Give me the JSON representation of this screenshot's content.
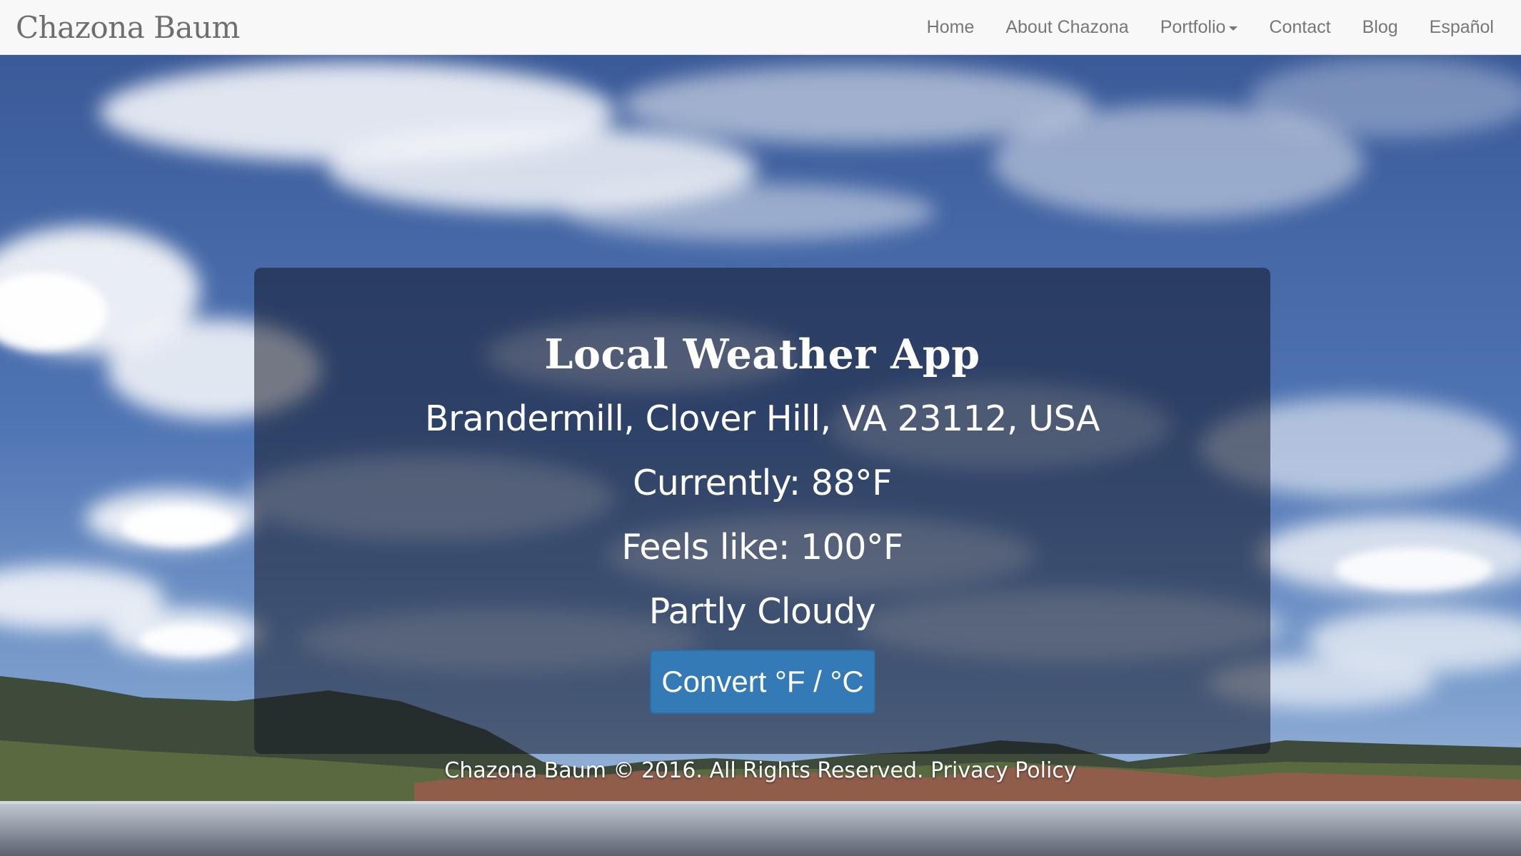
{
  "navbar": {
    "brand": "Chazona Baum",
    "items": [
      {
        "label": "Home"
      },
      {
        "label": "About Chazona"
      },
      {
        "label": "Portfolio",
        "has_dropdown": true
      },
      {
        "label": "Contact"
      },
      {
        "label": "Blog"
      },
      {
        "label": "Español"
      }
    ]
  },
  "weather": {
    "title": "Local Weather App",
    "location": "Brandermill, Clover Hill, VA 23112, USA",
    "current": "Currently: 88°F",
    "feels_like": "Feels like: 100°F",
    "condition": "Partly Cloudy",
    "convert_label": "Convert °F / °C"
  },
  "footer": {
    "copyright": "Chazona Baum © 2016. All Rights Reserved.",
    "privacy_link": "Privacy Policy"
  },
  "colors": {
    "button": "#337ab7",
    "navbar_bg": "#f8f8f8",
    "nav_text": "#777777"
  }
}
